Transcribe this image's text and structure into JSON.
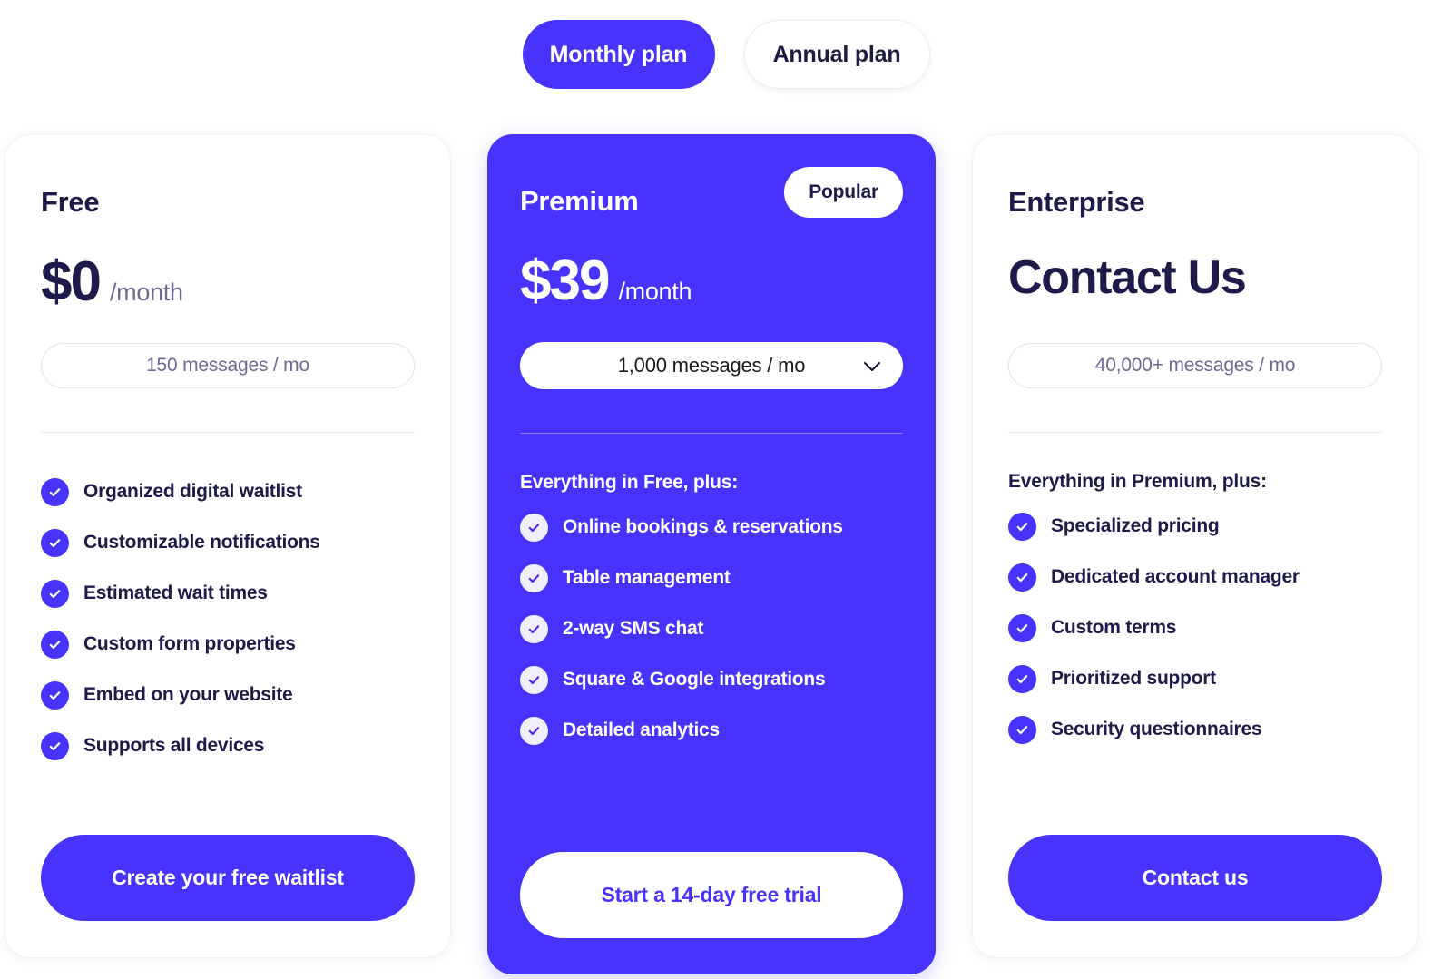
{
  "billing_toggle": {
    "options": [
      {
        "label": "Monthly plan",
        "selected": true
      },
      {
        "label": "Annual plan",
        "selected": false
      }
    ],
    "active_label": "Monthly plan",
    "inactive_label": "Annual plan"
  },
  "colors": {
    "accent": "#4733fb",
    "text_dark": "#1e1b4b",
    "text_muted": "#6d6a93",
    "card_border": "#f0f0f5",
    "divider_light": "#e6e5f0",
    "divider_on_accent": "#8b7dfc",
    "check_on_accent_bg": "#f1effe",
    "white": "#ffffff"
  },
  "plans": [
    {
      "id": "free",
      "title": "Free",
      "price": "$0",
      "period": "/month",
      "quota": "150 messages / mo",
      "quota_is_select": false,
      "features_heading": "",
      "features": [
        "Organized digital waitlist",
        "Customizable notifications",
        "Estimated wait times",
        "Custom form properties",
        "Embed on your website",
        "Supports all devices"
      ],
      "cta_label": "Create your free waitlist",
      "badge": ""
    },
    {
      "id": "premium",
      "title": "Premium",
      "price": "$39",
      "period": "/month",
      "quota": "1,000 messages / mo",
      "quota_is_select": true,
      "badge": "Popular",
      "features_heading": "Everything in Free, plus:",
      "features": [
        "Online bookings & reservations",
        "Table management",
        "2-way SMS chat",
        "Square & Google integrations",
        "Detailed analytics"
      ],
      "cta_label": "Start a 14-day free trial"
    },
    {
      "id": "enterprise",
      "title": "Enterprise",
      "price": "Contact Us",
      "period": "",
      "quota": "40,000+ messages / mo",
      "quota_is_select": false,
      "features_heading": "Everything in Premium, plus:",
      "features": [
        "Specialized pricing",
        "Dedicated account manager",
        "Custom terms",
        "Prioritized support",
        "Security questionnaires"
      ],
      "cta_label": "Contact us",
      "badge": ""
    }
  ]
}
